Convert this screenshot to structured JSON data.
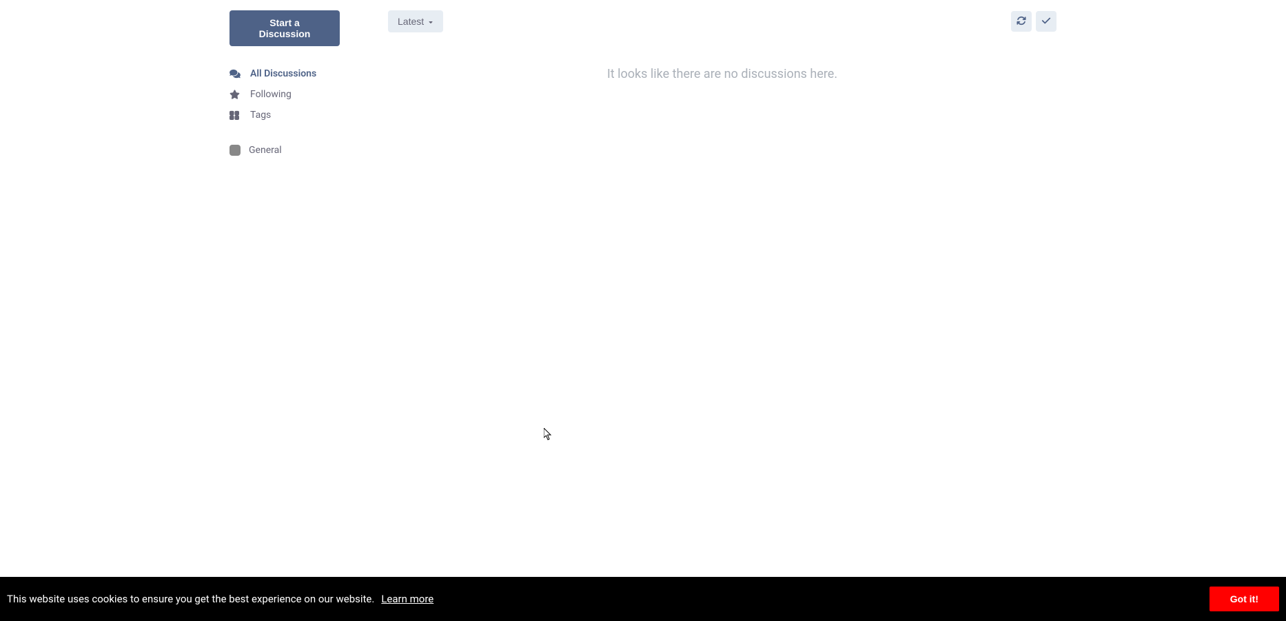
{
  "sidebar": {
    "start_button": "Start a Discussion",
    "nav": [
      {
        "label": "All Discussions",
        "icon": "comments",
        "active": true
      },
      {
        "label": "Following",
        "icon": "star",
        "active": false
      },
      {
        "label": "Tags",
        "icon": "grid",
        "active": false
      }
    ],
    "tags": [
      {
        "label": "General",
        "color": "#888"
      }
    ]
  },
  "toolbar": {
    "sort_label": "Latest",
    "refresh_title": "Refresh",
    "mark_read_title": "Mark All as Read"
  },
  "main": {
    "empty_message": "It looks like there are no discussions here."
  },
  "cookie": {
    "message": "This website uses cookies to ensure you get the best experience on our website.",
    "learn_more": "Learn more",
    "accept": "Got it!"
  }
}
